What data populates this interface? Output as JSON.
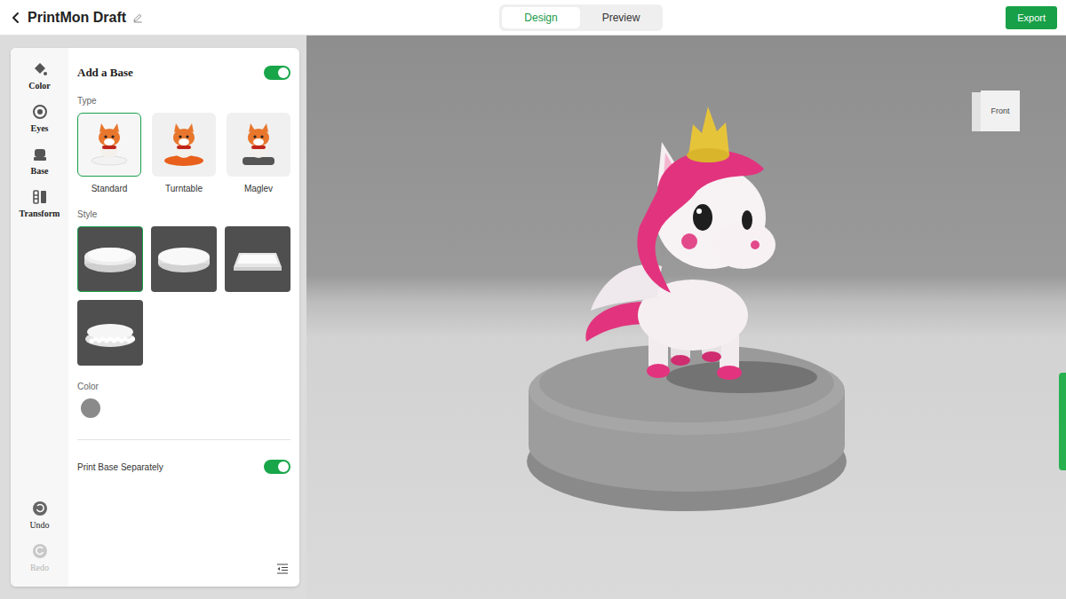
{
  "header": {
    "title": "PrintMon Draft"
  },
  "mode_tabs": [
    {
      "label": "Design",
      "selected": true
    },
    {
      "label": "Preview",
      "selected": false
    }
  ],
  "export_button": "Export",
  "rail": {
    "items": [
      {
        "label": "Color",
        "selected": false
      },
      {
        "label": "Eyes",
        "selected": false
      },
      {
        "label": "Base",
        "selected": true
      },
      {
        "label": "Transform",
        "selected": false
      }
    ],
    "history": [
      {
        "label": "Undo",
        "disabled": false
      },
      {
        "label": "Redo",
        "disabled": true
      }
    ]
  },
  "base_panel": {
    "title": "Add a Base",
    "enabled": true,
    "type_label": "Type",
    "types": [
      {
        "label": "Standard",
        "kind": "standard",
        "selected": true
      },
      {
        "label": "Turntable",
        "kind": "turntable",
        "selected": false
      },
      {
        "label": "Maglev",
        "kind": "maglev",
        "selected": false
      }
    ],
    "style_label": "Style",
    "styles": [
      {
        "kind": "round-beveled",
        "selected": true
      },
      {
        "kind": "round-flat",
        "selected": false
      },
      {
        "kind": "square",
        "selected": false
      },
      {
        "kind": "fluffy",
        "selected": false
      }
    ],
    "color_label": "Color",
    "base_color": "#8a8a8a",
    "separate": {
      "label": "Print Base Separately",
      "on": true
    }
  },
  "viewport": {
    "view_cube": "Front"
  }
}
